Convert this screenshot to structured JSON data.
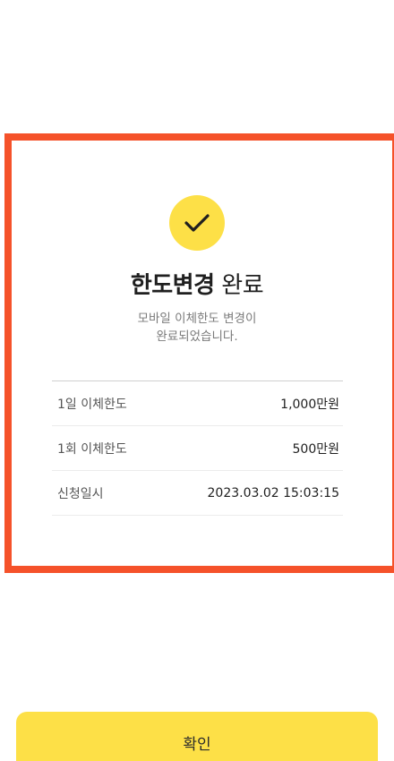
{
  "result": {
    "icon": "check-icon",
    "accent_color": "#fde047",
    "frame_color": "#f5522a",
    "title_bold": "한도변경",
    "title_normal": "완료",
    "message_line1": "모바일 이체한도 변경이",
    "message_line2": "완료되었습니다."
  },
  "details": [
    {
      "label": "1일 이체한도",
      "value": "1,000만원"
    },
    {
      "label": "1회 이체한도",
      "value": "500만원"
    },
    {
      "label": "신청일시",
      "value": "2023.03.02 15:03:15"
    }
  ],
  "actions": {
    "confirm_label": "확인"
  }
}
